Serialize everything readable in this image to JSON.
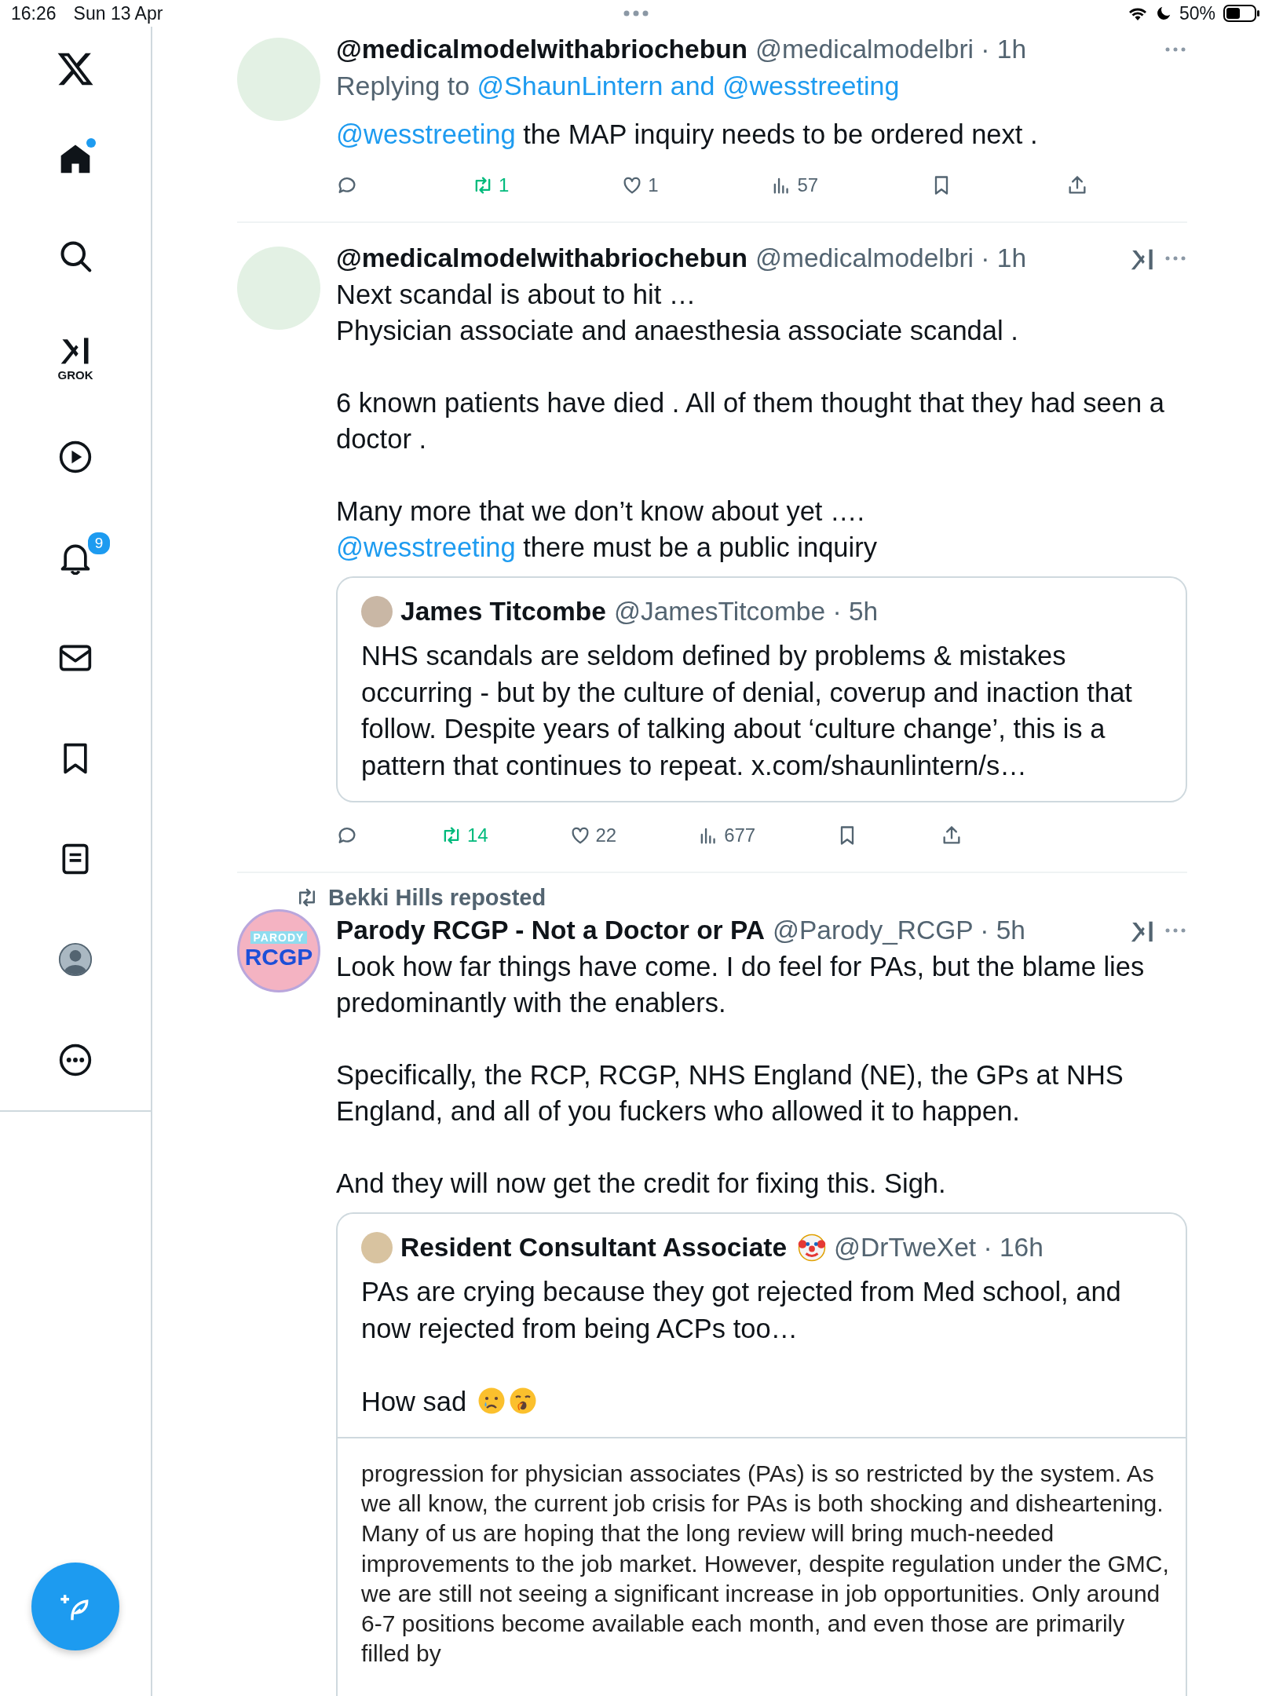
{
  "status_bar": {
    "time": "16:26",
    "date": "Sun 13 Apr",
    "battery": "50%",
    "do_not_disturb": true
  },
  "sidebar": {
    "home_unread": true,
    "grok_label": "GROK",
    "notifications_badge": "9"
  },
  "tweets": [
    {
      "avatar": {
        "kind": "cartoon"
      },
      "name": "@medicalmodelwithabriochebun",
      "meta": "@medicalmodelbri · 1h",
      "grok_button": false,
      "replying_to": [
        {
          "kind": "plain",
          "text": "Replying to "
        },
        {
          "kind": "mention",
          "text": "@ShaunLintern and @wesstreeting"
        }
      ],
      "text": [
        {
          "kind": "mention",
          "text": "@wesstreeting"
        },
        {
          "kind": "plain",
          "text": " the MAP inquiry needs to be ordered next ."
        }
      ],
      "actions": [
        {
          "kind": "reply"
        },
        {
          "kind": "repost",
          "count": "1",
          "active": true
        },
        {
          "kind": "like",
          "count": "1",
          "active": false
        },
        {
          "kind": "views",
          "count": "57"
        },
        {
          "kind": "bookmark",
          "active": false
        },
        {
          "kind": "share"
        }
      ]
    },
    {
      "avatar": {
        "kind": "cartoon"
      },
      "name": "@medicalmodelwithabriochebun",
      "meta": "@medicalmodelbri · 1h",
      "grok_button": true,
      "text": [
        {
          "kind": "plain",
          "text": "Next scandal is about to hit …\nPhysician associate and anaesthesia associate scandal .\n\n6 known patients have died . All of them thought that they had seen a doctor .\n\nMany more that we don’t know about yet ….\n"
        },
        {
          "kind": "mention",
          "text": "@wesstreeting"
        },
        {
          "kind": "plain",
          "text": " there must be a public inquiry"
        }
      ],
      "quote": {
        "avatar": {
          "kind": "photo"
        },
        "name": "James Titcombe",
        "meta": "@JamesTitcombe · 5h",
        "text": "NHS scandals are seldom defined by problems & mistakes occurring - but by the culture of denial, coverup and inaction that follow. Despite years of talking about ‘culture change’, this is a pattern that continues to repeat. x.com/shaunlintern/s…"
      },
      "actions": [
        {
          "kind": "reply"
        },
        {
          "kind": "repost",
          "count": "14",
          "active": true
        },
        {
          "kind": "like",
          "count": "22",
          "active": false
        },
        {
          "kind": "views",
          "count": "677"
        },
        {
          "kind": "bookmark",
          "active": false
        },
        {
          "kind": "share"
        }
      ]
    },
    {
      "reposted_by": "Bekki Hills reposted",
      "avatar": {
        "kind": "logo",
        "top_text": "PARODY",
        "main_text": "RCGP"
      },
      "name": "Parody RCGP - Not a Doctor or PA",
      "meta": "@Parody_RCGP · 5h",
      "grok_button": true,
      "text": [
        {
          "kind": "plain",
          "text": "Look how far things have come. I do feel for PAs, but the blame lies predominantly with the enablers.\n\nSpecifically, the RCP, RCGP, NHS England (NE), the GPs at NHS England, and all of you fuckers who allowed it to happen.\n\nAnd they will now get the credit for fixing this. Sigh."
        }
      ],
      "quote": {
        "avatar": {
          "kind": "photo"
        },
        "name": "Resident Consultant Associate",
        "name_emojis": [
          {
            "kind": "clown"
          }
        ],
        "meta": "@DrTweXet · 16h",
        "text": "PAs are crying because they got rejected from Med school, and now rejected from being ACPs too…\n\nHow sad ",
        "text_emojis": [
          {
            "kind": "crying"
          },
          {
            "kind": "yawning"
          }
        ],
        "image": {
          "kind": "document_screenshot",
          "text": "progression for physician associates (PAs) is so restricted by the system. As we all know, the current job crisis for PAs is both shocking and disheartening. Many of us are hoping that the long review will bring much-needed improvements to the job market. However, despite regulation under the GMC, we are still not seeing a significant increase in job opportunities. Only around 6-7 positions become available each month, and even those are primarily filled by"
        }
      }
    }
  ]
}
